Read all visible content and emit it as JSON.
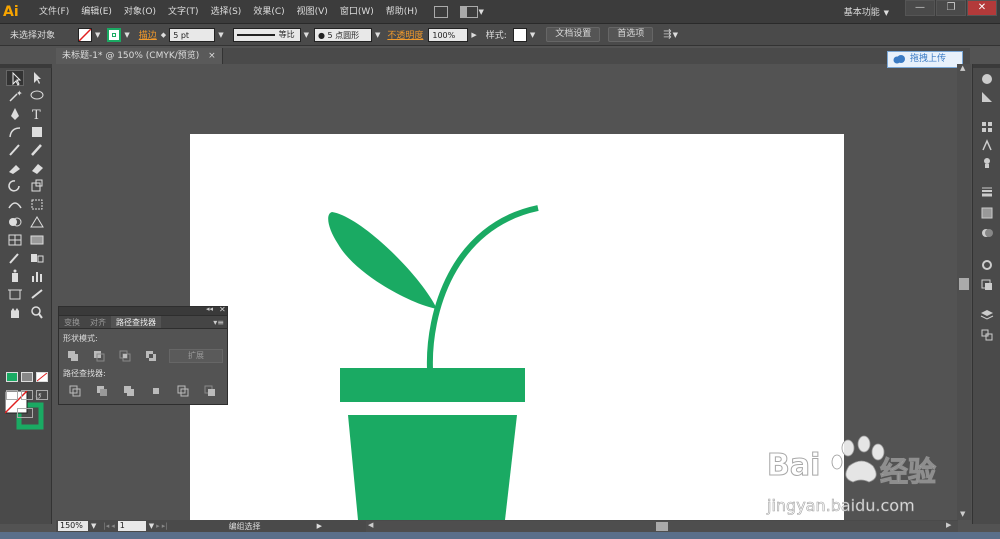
{
  "app": {
    "logo": "Ai",
    "menus": [
      "文件(F)",
      "编辑(E)",
      "对象(O)",
      "文字(T)",
      "选择(S)",
      "效果(C)",
      "视图(V)",
      "窗口(W)",
      "帮助(H)"
    ],
    "workspace": "基本功能"
  },
  "control_bar": {
    "selection_status": "未选择对象",
    "stroke_label": "描边",
    "stroke_weight": "5 pt",
    "stroke_profile": "等比",
    "brush": "5 点圆形",
    "opacity_label": "不透明度",
    "opacity_value": "100%",
    "style_label": "样式:",
    "doc_setup_button": "文档设置",
    "preferences_button": "首选项"
  },
  "document": {
    "tab_title": "未标题-1* @ 150% (CMYK/预览)",
    "tab_close": "×"
  },
  "upload_button": "拖拽上传",
  "pathfinder_panel": {
    "tabs": [
      "变换",
      "对齐",
      "路径查找器"
    ],
    "active_tab": "路径查找器",
    "shape_modes_label": "形状模式:",
    "expand_button": "扩展",
    "pathfinders_label": "路径查找器:"
  },
  "status_bar": {
    "zoom": "150%",
    "page": "1",
    "tool_status": "编组选择"
  },
  "watermark": {
    "brand": "Bai",
    "brand2": "经验",
    "url": "jingyan.baidu.com"
  },
  "colors": {
    "plant_green": "#1aaa63",
    "ui_dark": "#3c3c3c",
    "ui_mid": "#4a4a4a",
    "canvas_bg": "#535353"
  }
}
